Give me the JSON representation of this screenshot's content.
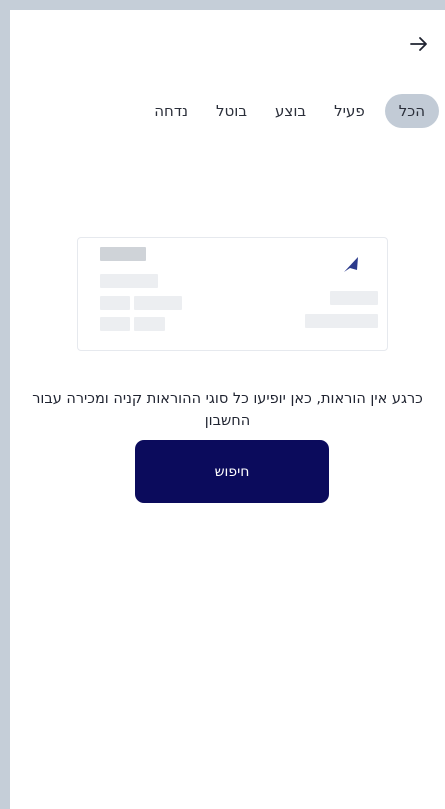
{
  "header": {
    "back_icon": "arrow-right-icon"
  },
  "tabs": [
    {
      "label": "הכל",
      "active": true
    },
    {
      "label": "פעיל",
      "active": false
    },
    {
      "label": "בוצע",
      "active": false
    },
    {
      "label": "בוטל",
      "active": false
    },
    {
      "label": "נדחה",
      "active": false
    }
  ],
  "illustration": {
    "icon": "navigation-arrow-icon",
    "accent": "#2b3a8c"
  },
  "empty_state": {
    "message": "כרגע אין הוראות, כאן יופיעו כל סוגי ההוראות קניה ומכירה עבור החשבון"
  },
  "search_button": {
    "label": "חיפוש",
    "color": "#0b0b5c"
  }
}
